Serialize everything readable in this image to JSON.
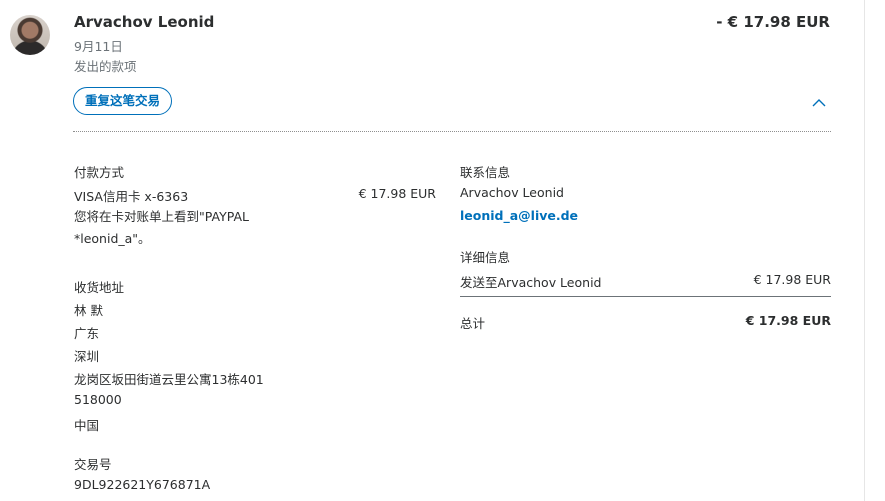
{
  "header": {
    "name": "Arvachov Leonid",
    "date": "9月11日",
    "type": "发出的款项",
    "amount": "- € 17.98 EUR",
    "repeat_label": "重复这笔交易"
  },
  "payment": {
    "heading": "付款方式",
    "method": "VISA信用卡 x-6363",
    "amount": "€ 17.98 EUR",
    "statement_line1": "您将在卡对账单上看到\"PAYPAL",
    "statement_line2": "*leonid_a\"。"
  },
  "shipping": {
    "heading": "收货地址",
    "lines": [
      "林 默",
      "广东",
      "深圳",
      "龙岗区坂田街道云里公寓13栋401",
      "518000",
      "中国"
    ]
  },
  "transaction": {
    "heading": "交易号",
    "id": "9DL922621Y676871A"
  },
  "contact": {
    "heading": "联系信息",
    "name": "Arvachov Leonid",
    "email": "leonid_a@live.de"
  },
  "details": {
    "heading": "详细信息",
    "sent_to": "发送至Arvachov Leonid",
    "sent_amount": "€ 17.98 EUR",
    "total_label": "总计",
    "total_amount": "€ 17.98 EUR"
  },
  "icons": {
    "avatar": "avatar",
    "collapse": "chevron-up-icon"
  },
  "colors": {
    "accent": "#0070ba",
    "text": "#2c2e2f",
    "muted": "#6c7378"
  }
}
